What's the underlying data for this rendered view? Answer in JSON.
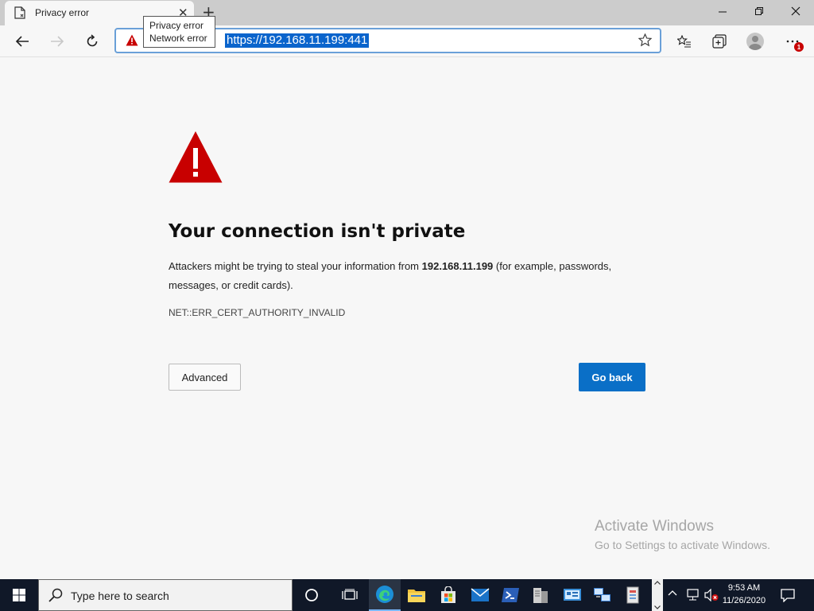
{
  "tab": {
    "title": "Privacy error",
    "close": "✕",
    "new_tab": "+"
  },
  "window": {
    "minimize": "—",
    "restore": "❐",
    "close": "✕"
  },
  "tooltip": {
    "line1": "Privacy error",
    "line2": "Network error"
  },
  "address": {
    "url": "https://192.168.11.199:441"
  },
  "toolbar": {
    "menu_badge": "1"
  },
  "page": {
    "heading": "Your connection isn't private",
    "desc_before": "Attackers might be trying to steal your information from ",
    "desc_host": "192.168.11.199",
    "desc_after": " (for example, passwords, messages, or credit cards).",
    "error_code": "NET::ERR_CERT_AUTHORITY_INVALID",
    "advanced_label": "Advanced",
    "goback_label": "Go back"
  },
  "watermark": {
    "title": "Activate Windows",
    "subtitle": "Go to Settings to activate Windows."
  },
  "taskbar": {
    "search_placeholder": "Type here to search",
    "time": "9:53 AM",
    "date": "11/26/2020"
  },
  "colors": {
    "accent": "#0a6fc7",
    "warning": "#c80000",
    "taskbar": "#101828"
  }
}
